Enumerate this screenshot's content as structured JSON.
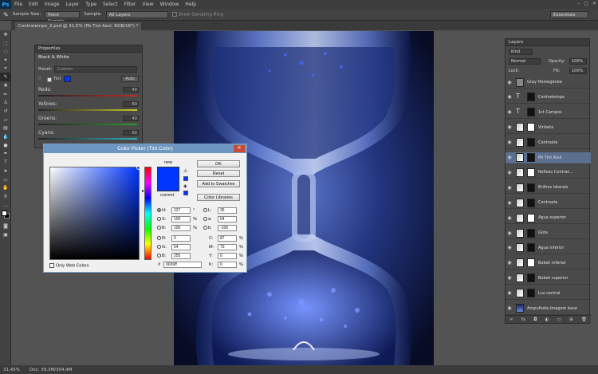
{
  "app": {
    "logo": "Ps"
  },
  "menu": [
    "File",
    "Edit",
    "Image",
    "Layer",
    "Type",
    "Select",
    "Filter",
    "View",
    "Window",
    "Help"
  ],
  "window_controls": [
    "–",
    "▢",
    "✕"
  ],
  "options": {
    "sample_size_label": "Sample Size:",
    "sample_size_value": "Point Sample",
    "sample_label": "Sample:",
    "sample_value": "All Layers",
    "show_ring_label": "Show Sampling Ring",
    "workspace": "Essentials"
  },
  "document_tab": "Contratempo_2.psd @ 31,5% (Pb Tint Azul, RGB/16*) *",
  "properties": {
    "title": "Properties",
    "adjustment": "Black & White",
    "preset_label": "Preset:",
    "preset_value": "Custom",
    "tint_label": "Tint",
    "auto_label": "Auto",
    "sliders": [
      {
        "label": "Reds:",
        "color": "#c62828",
        "value": 40
      },
      {
        "label": "Yellows:",
        "color": "#c9c925",
        "value": 60
      },
      {
        "label": "Greens:",
        "color": "#2e9b2e",
        "value": 40
      },
      {
        "label": "Cyans:",
        "color": "#29b6c6",
        "value": 60
      }
    ]
  },
  "color_picker": {
    "title": "Color Picker (Tint Color)",
    "close": "✕",
    "new_label": "new",
    "current_label": "current",
    "new_color": "#0036ff",
    "current_color": "#0036ff",
    "ok": "OK",
    "reset": "Reset",
    "add_swatches": "Add to Swatches",
    "color_libraries": "Color Libraries",
    "only_web": "Only Web Colors",
    "hsb": [
      {
        "label": "H:",
        "value": "227",
        "unit": "°"
      },
      {
        "label": "S:",
        "value": "100",
        "unit": "%"
      },
      {
        "label": "B:",
        "value": "100",
        "unit": "%"
      }
    ],
    "rgb": [
      {
        "label": "R:",
        "value": "0"
      },
      {
        "label": "G:",
        "value": "54"
      },
      {
        "label": "B:",
        "value": "255"
      }
    ],
    "lab": [
      {
        "label": "L:",
        "value": "35"
      },
      {
        "label": "a:",
        "value": "54"
      },
      {
        "label": "b:",
        "value": "-106"
      }
    ],
    "cmyk": [
      {
        "label": "C:",
        "value": "87",
        "unit": "%"
      },
      {
        "label": "M:",
        "value": "73",
        "unit": "%"
      },
      {
        "label": "Y:",
        "value": "0",
        "unit": "%"
      },
      {
        "label": "K:",
        "value": "0",
        "unit": "%"
      }
    ],
    "hex_label": "#",
    "hex_value": "0036ff"
  },
  "layers_panel": {
    "title": "Layers",
    "kind": "Kind",
    "blend": "Normal",
    "opacity_label": "Opacity:",
    "opacity": "100%",
    "lock_label": "Lock:",
    "fill_label": "Fill:",
    "fill": "100%",
    "layers": [
      {
        "name": "Gray Homogenea",
        "kind": "fill"
      },
      {
        "name": "Contratempo",
        "kind": "text"
      },
      {
        "name": "1ct Campos",
        "kind": "text"
      },
      {
        "name": "Vinheta",
        "kind": "adj"
      },
      {
        "name": "Contraste",
        "kind": "adj"
      },
      {
        "name": "Pb Tint Azul",
        "kind": "adj"
      },
      {
        "name": "Reflexo Contrat...",
        "kind": "adj"
      },
      {
        "name": "Brilhos laterais",
        "kind": "adj"
      },
      {
        "name": "Contraste",
        "kind": "adj"
      },
      {
        "name": "Agua superior",
        "kind": "adj"
      },
      {
        "name": "Gota",
        "kind": "adj"
      },
      {
        "name": "Agua inferior",
        "kind": "adj"
      },
      {
        "name": "Bokeh inferior",
        "kind": "adj"
      },
      {
        "name": "Bokeh superior",
        "kind": "adj"
      },
      {
        "name": "Luz central",
        "kind": "adj"
      },
      {
        "name": "Ampulheta Imagem base",
        "kind": "image"
      }
    ]
  },
  "status": {
    "zoom": "31,45%",
    "doc": "Doc: 39,3M/304,4M"
  },
  "colors": {
    "accent": "#0036ff",
    "selection": "#5b6f8f"
  }
}
